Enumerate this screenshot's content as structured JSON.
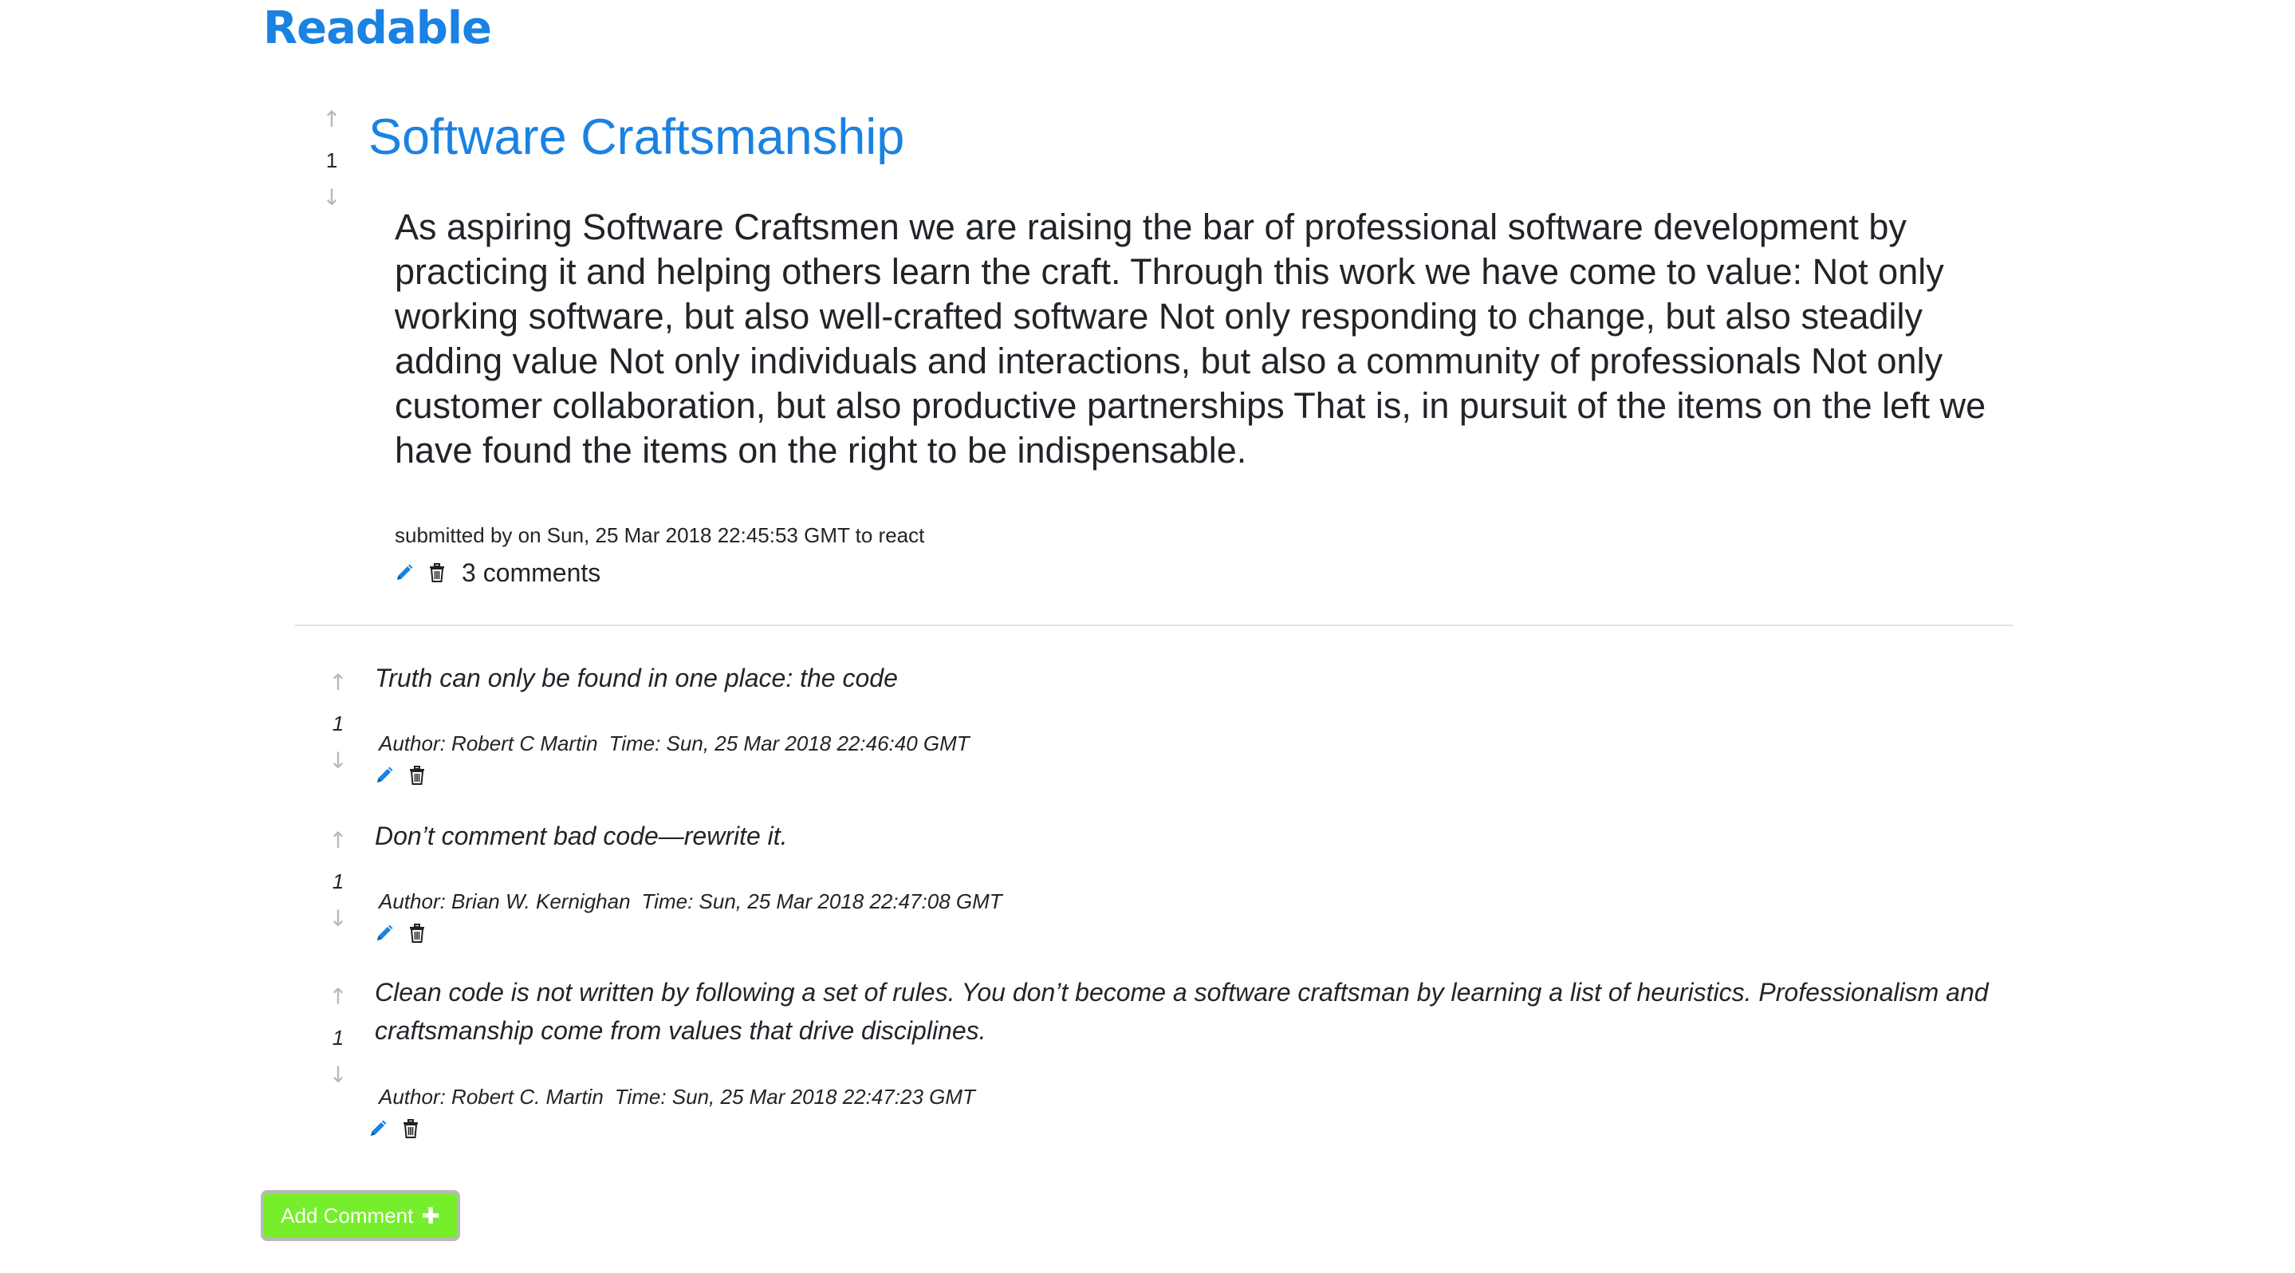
{
  "app": {
    "brand": "Readable"
  },
  "post": {
    "title": "Software Craftsmanship",
    "vote_score": "1",
    "body": "As aspiring Software Craftsmen we are raising the bar of professional software development by practicing it and helping others learn the craft. Through this work we have come to value: Not only working software, but also well-crafted software Not only responding to change, but also steadily adding value Not only individuals and interactions, but also a community of professionals Not only customer collaboration, but also productive partnerships That is, in pursuit of the items on the left we have found the items on the right to be indispensable.",
    "submitted": "submitted by on Sun, 25 Mar 2018 22:45:53 GMT to react",
    "comments_count": "3 comments"
  },
  "comments": [
    {
      "body": "Truth can only be found in one place: the code",
      "vote_score": "1",
      "author": "Author: Robert C Martin",
      "time": "Time: Sun, 25 Mar 2018 22:46:40 GMT"
    },
    {
      "body": "Don’t comment bad code—rewrite it.",
      "vote_score": "1",
      "author": "Author: Brian W. Kernighan",
      "time": "Time: Sun, 25 Mar 2018 22:47:08 GMT"
    },
    {
      "body": "Clean code is not written by following a set of rules. You don’t become a software craftsman by learning a list of heuristics. Professionalism and craftsmanship come from values that drive disciplines.",
      "vote_score": "1",
      "author": "Author: Robert C. Martin",
      "time": "Time: Sun, 25 Mar 2018 22:47:23 GMT"
    }
  ],
  "actions": {
    "add_comment_label": "Add Comment",
    "add_comment_icon": "plus-icon"
  },
  "icons": {
    "upvote": "arrow-up-icon",
    "downvote": "arrow-down-icon",
    "edit": "pencil-icon",
    "delete": "trash-icon"
  },
  "colors": {
    "brand_blue": "#1a82e2",
    "add_button_green": "#76ee2c",
    "vote_arrow_gray": "#b8b8b8",
    "text": "#212529"
  }
}
